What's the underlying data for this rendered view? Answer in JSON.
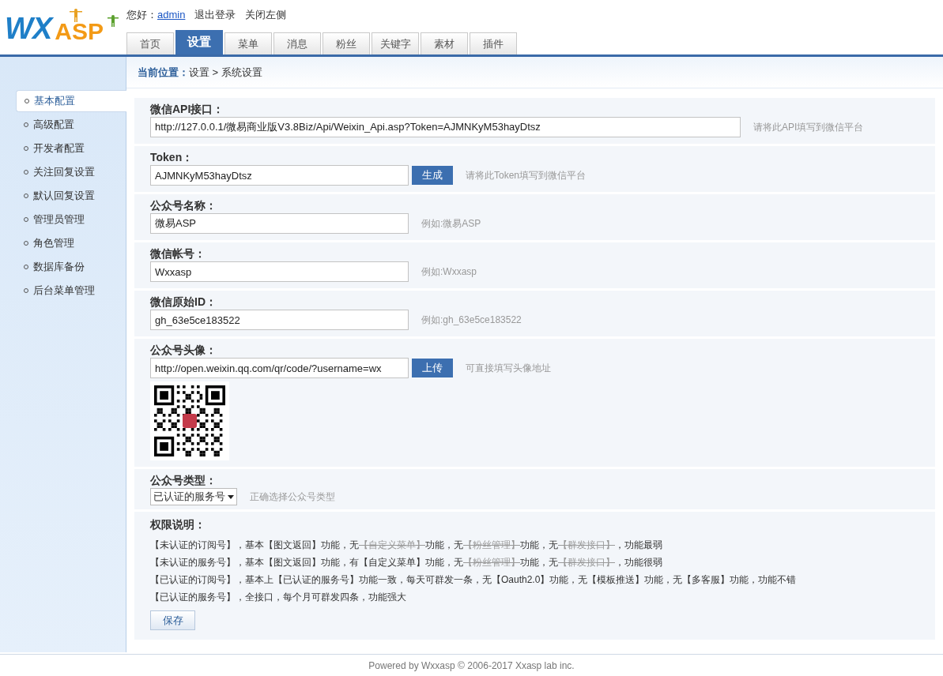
{
  "logo": {
    "part_1": "WX",
    "part_2": "ASP"
  },
  "top_links": {
    "greeting": "您好：",
    "user": "admin",
    "logout": "退出登录",
    "close_left": "关闭左侧"
  },
  "tabs": [
    {
      "label": "首页",
      "selected": false
    },
    {
      "label": "设置",
      "selected": true
    },
    {
      "label": "菜单",
      "selected": false
    },
    {
      "label": "消息",
      "selected": false
    },
    {
      "label": "粉丝",
      "selected": false
    },
    {
      "label": "关键字",
      "selected": false
    },
    {
      "label": "素材",
      "selected": false
    },
    {
      "label": "插件",
      "selected": false
    }
  ],
  "breadcrumb": {
    "label": "当前位置：",
    "path": "设置 > 系统设置"
  },
  "sidebar": {
    "items": [
      {
        "label": "基本配置",
        "selected": true
      },
      {
        "label": "高级配置",
        "selected": false
      },
      {
        "label": "开发者配置",
        "selected": false
      },
      {
        "label": "关注回复设置",
        "selected": false
      },
      {
        "label": "默认回复设置",
        "selected": false
      },
      {
        "label": "管理员管理",
        "selected": false
      },
      {
        "label": "角色管理",
        "selected": false
      },
      {
        "label": "数据库备份",
        "selected": false
      },
      {
        "label": "后台菜单管理",
        "selected": false
      }
    ]
  },
  "form": {
    "fields": [
      {
        "kind": "wide",
        "label": "微信API接口：",
        "value": "http://127.0.0.1/微易商业版V3.8Biz/Api/Weixin_Api.asp?Token=AJMNKyM53hayDtsz",
        "hint": "请将此API填写到微信平台"
      },
      {
        "kind": "button",
        "label": "Token：",
        "value": "AJMNKyM53hayDtsz",
        "button": "生成",
        "hint": "请将此Token填写到微信平台"
      },
      {
        "kind": "text",
        "label": "公众号名称：",
        "value": "微易ASP",
        "hint": "例如:微易ASP"
      },
      {
        "kind": "text",
        "label": "微信帐号：",
        "value": "Wxxasp",
        "hint": "例如:Wxxasp"
      },
      {
        "kind": "text",
        "label": "微信原始ID：",
        "value": "gh_63e5ce183522",
        "hint": "例如:gh_63e5ce183522"
      },
      {
        "kind": "image",
        "label": "公众号头像：",
        "value": "http://open.weixin.qq.com/qr/code/?username=wx",
        "button": "上传",
        "hint": "可直接填写头像地址"
      },
      {
        "kind": "select",
        "label": "公众号类型：",
        "value": "已认证的服务号",
        "hint": "正确选择公众号类型"
      }
    ],
    "permissions": {
      "title": "权限说明：",
      "lines": [
        [
          {
            "text": "【未认证的订阅号】，基本【图文返回】功能，无",
            "struck": false
          },
          {
            "text": "【自定义菜单】",
            "struck": true
          },
          {
            "text": "功能，无",
            "struck": false
          },
          {
            "text": "【粉丝管理】",
            "struck": true
          },
          {
            "text": "功能，无",
            "struck": false
          },
          {
            "text": "【群发接口】",
            "struck": true
          },
          {
            "text": "，功能最弱",
            "struck": false
          }
        ],
        [
          {
            "text": "【未认证的服务号】，基本【图文返回】功能，有【自定义菜单】功能，无",
            "struck": false
          },
          {
            "text": "【粉丝管理】",
            "struck": true
          },
          {
            "text": "功能，无",
            "struck": false
          },
          {
            "text": "【群发接口】",
            "struck": true
          },
          {
            "text": "，功能很弱",
            "struck": false
          }
        ],
        [
          {
            "text": "【已认证的订阅号】，基本上【已认证的服务号】功能一致，每天可群发一条，无【Oauth2.0】功能，无【模板推送】功能，无【多客服】功能，功能不错",
            "struck": false
          }
        ],
        [
          {
            "text": "【已认证的服务号】，全接口，每个月可群发四条，功能强大",
            "struck": false
          }
        ]
      ]
    },
    "save_button": "保存"
  },
  "footer": "Powered by Wxxasp © 2006-2017 Xxasp lab inc."
}
